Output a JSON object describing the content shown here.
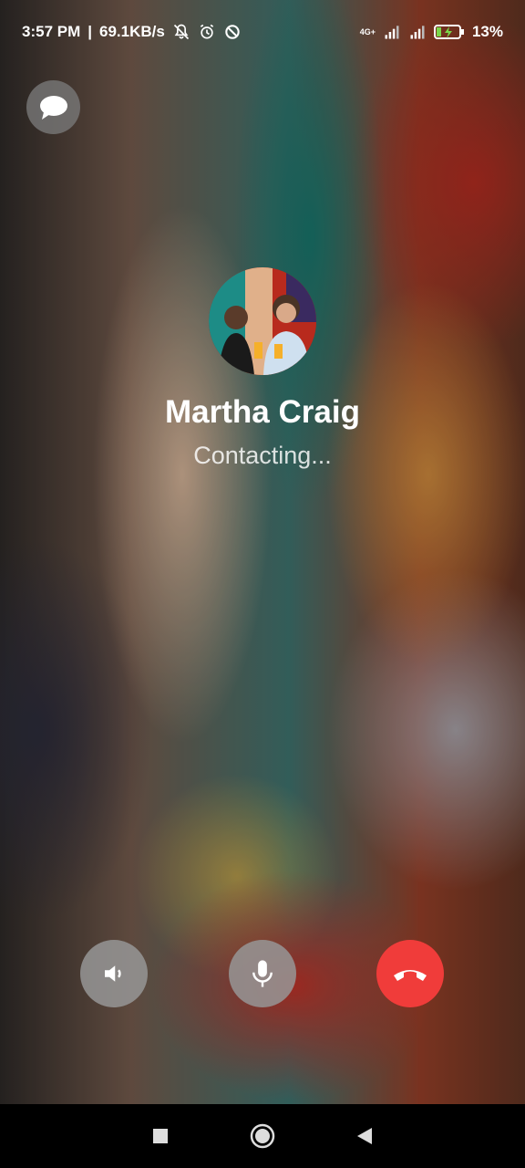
{
  "status_bar": {
    "time": "3:57 PM",
    "separator": "|",
    "net_speed": "69.1KB/s",
    "network_label": "4G+",
    "battery": "13%",
    "icons": [
      "bell-off-icon",
      "alarm-icon",
      "data-saver-icon",
      "signal-icon",
      "signal-icon",
      "battery-charging-icon"
    ]
  },
  "call": {
    "caller_name": "Martha Craig",
    "status": "Contacting..."
  },
  "controls": {
    "speaker_icon": "speaker-icon",
    "mic_icon": "microphone-icon",
    "end_icon": "end-call-icon"
  },
  "colors": {
    "end_call": "#f03c3a",
    "control_bg": "#969696"
  },
  "nav": {
    "icons": [
      "recents-icon",
      "home-icon",
      "back-icon"
    ]
  }
}
